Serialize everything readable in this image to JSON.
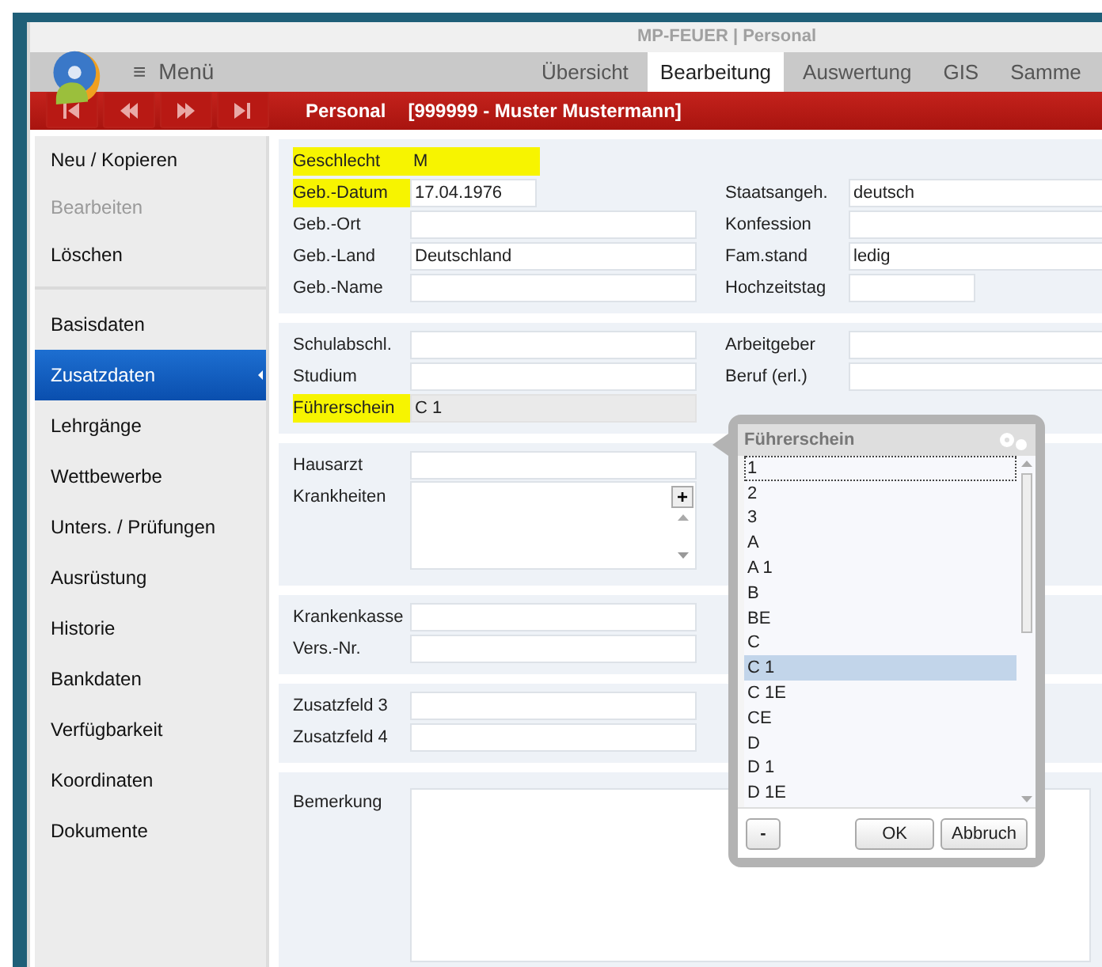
{
  "window": {
    "title": "MP-FEUER | Personal"
  },
  "menu": {
    "icon": "≡",
    "label": "Menü"
  },
  "tabs": [
    {
      "label": "Übersicht",
      "selected": false
    },
    {
      "label": "Bearbeitung",
      "selected": true
    },
    {
      "label": "Auswertung",
      "selected": false
    },
    {
      "label": "GIS",
      "selected": false
    },
    {
      "label": "Samme",
      "selected": false
    }
  ],
  "toolbar": {
    "module": "Personal",
    "record": "[999999 - Muster Mustermann]"
  },
  "sidebar": {
    "actions": [
      {
        "label": "Neu / Kopieren",
        "disabled": false
      },
      {
        "label": "Bearbeiten",
        "disabled": true
      },
      {
        "label": "Löschen",
        "disabled": false
      }
    ],
    "items": [
      {
        "label": "Basisdaten",
        "selected": false
      },
      {
        "label": "Zusatzdaten",
        "selected": true
      },
      {
        "label": "Lehrgänge",
        "selected": false
      },
      {
        "label": "Wettbewerbe",
        "selected": false
      },
      {
        "label": "Unters. / Prüfungen",
        "selected": false
      },
      {
        "label": "Ausrüstung",
        "selected": false
      },
      {
        "label": "Historie",
        "selected": false
      },
      {
        "label": "Bankdaten",
        "selected": false
      },
      {
        "label": "Verfügbarkeit",
        "selected": false
      },
      {
        "label": "Koordinaten",
        "selected": false
      },
      {
        "label": "Dokumente",
        "selected": false
      }
    ]
  },
  "sections": [
    {
      "rows": [
        {
          "left": {
            "label": "Geschlecht",
            "value": "M",
            "kind": "plain",
            "highlighted": true
          }
        },
        {
          "left": {
            "label": "Geb.-Datum",
            "value": "17.04.1976",
            "kind": "text",
            "short": true,
            "highlighted": true
          },
          "right": {
            "label": "Staatsangeh.",
            "value": "deutsch",
            "kind": "text",
            "highlighted": false
          }
        },
        {
          "left": {
            "label": "Geb.-Ort",
            "kind": "text",
            "highlighted": false
          },
          "right": {
            "label": "Konfession",
            "kind": "text",
            "highlighted": false
          }
        },
        {
          "left": {
            "label": "Geb.-Land",
            "value": "Deutschland",
            "kind": "text",
            "highlighted": false
          },
          "right": {
            "label": "Fam.stand",
            "value": "ledig",
            "kind": "text",
            "highlighted": false
          }
        },
        {
          "left": {
            "label": "Geb.-Name",
            "kind": "text",
            "highlighted": false
          },
          "right": {
            "label": "Hochzeitstag",
            "kind": "text",
            "short": true,
            "highlighted": false
          }
        }
      ]
    },
    {
      "rows": [
        {
          "left": {
            "label": "Schulabschl.",
            "kind": "text",
            "highlighted": false
          },
          "right": {
            "label": "Arbeitgeber",
            "kind": "text",
            "highlighted": false
          }
        },
        {
          "left": {
            "label": "Studium",
            "kind": "text",
            "highlighted": false
          },
          "right": {
            "label": "Beruf (erl.)",
            "kind": "text",
            "highlighted": false
          }
        },
        {
          "left": {
            "label": "Führerschein",
            "value": "C 1",
            "kind": "readonly",
            "highlighted": true
          }
        }
      ]
    },
    {
      "rows": [
        {
          "left": {
            "label": "Hausarzt",
            "kind": "text",
            "highlighted": false
          }
        },
        {
          "left": {
            "label": "Krankheiten",
            "kind": "list",
            "add": "+",
            "highlighted": false
          }
        }
      ]
    },
    {
      "rows": [
        {
          "left": {
            "label": "Krankenkasse",
            "kind": "text",
            "highlighted": false
          }
        },
        {
          "left": {
            "label": "Vers.-Nr.",
            "kind": "text",
            "highlighted": false
          }
        }
      ]
    },
    {
      "rows": [
        {
          "left": {
            "label": "Zusatzfeld 3",
            "kind": "text",
            "highlighted": false
          }
        },
        {
          "left": {
            "label": "Zusatzfeld 4",
            "kind": "text",
            "highlighted": false
          }
        }
      ]
    },
    {
      "rows": [
        {
          "left": {
            "label": "Bemerkung",
            "kind": "memo",
            "highlighted": false
          }
        }
      ]
    }
  ],
  "popup": {
    "title": "Führerschein",
    "items": [
      {
        "label": "1",
        "selected": false,
        "focused": true
      },
      {
        "label": "2",
        "selected": false,
        "focused": false
      },
      {
        "label": "3",
        "selected": false,
        "focused": false
      },
      {
        "label": "A",
        "selected": false,
        "focused": false
      },
      {
        "label": "A 1",
        "selected": false,
        "focused": false
      },
      {
        "label": "B",
        "selected": false,
        "focused": false
      },
      {
        "label": "BE",
        "selected": false,
        "focused": false
      },
      {
        "label": "C",
        "selected": false,
        "focused": false
      },
      {
        "label": "C 1",
        "selected": true,
        "focused": false
      },
      {
        "label": "C 1E",
        "selected": false,
        "focused": false
      },
      {
        "label": "CE",
        "selected": false,
        "focused": false
      },
      {
        "label": "D",
        "selected": false,
        "focused": false
      },
      {
        "label": "D 1",
        "selected": false,
        "focused": false
      },
      {
        "label": "D 1E",
        "selected": false,
        "focused": false
      }
    ],
    "remove": "-",
    "ok": "OK",
    "cancel": "Abbruch"
  }
}
